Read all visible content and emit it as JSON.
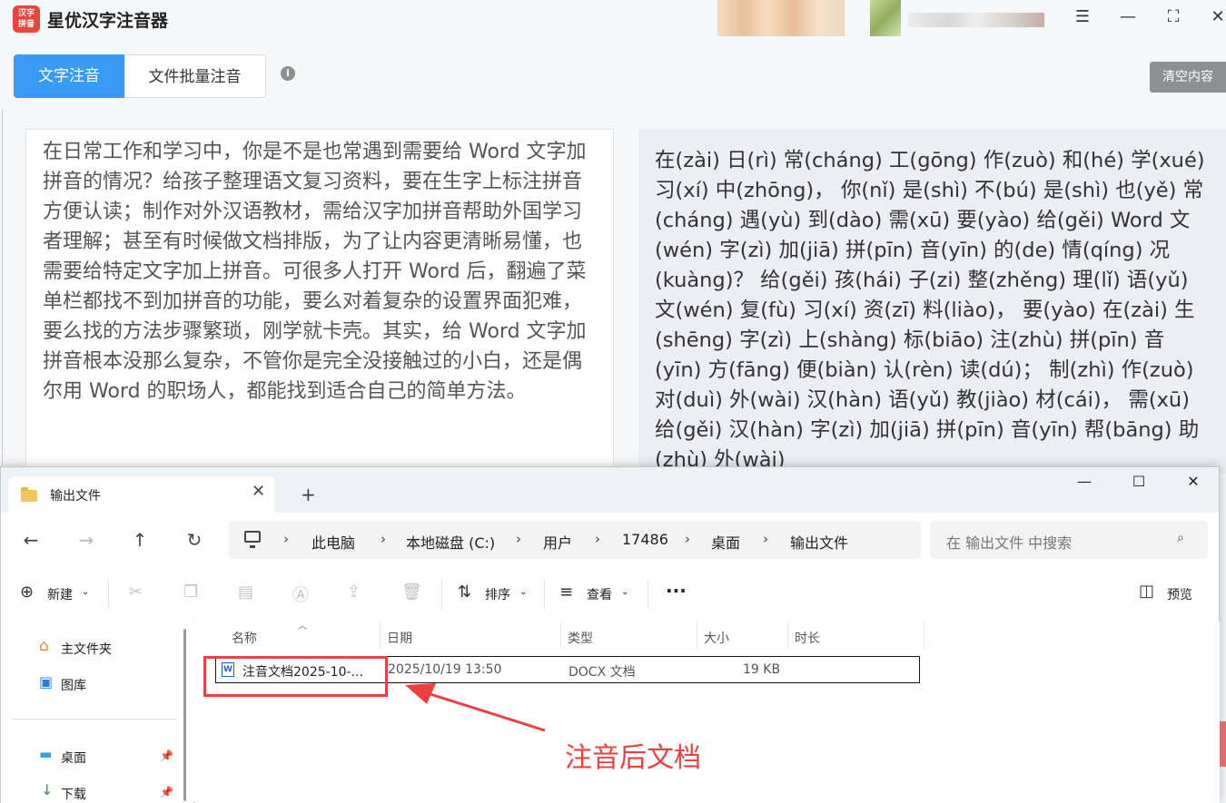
{
  "app": {
    "name": "星优汉字注音器",
    "logo_text": "汉字拼音",
    "tabs": [
      {
        "label": "文字注音"
      },
      {
        "label": "文件批量注音"
      }
    ],
    "clear_button": "清空内容",
    "input_text": "在日常工作和学习中，你是不是也常遇到需要给 Word 文字加拼音的情况？给孩子整理语文复习资料，要在生字上标注拼音方便认读；制作对外汉语教材，需给汉字加拼音帮助外国学习者理解；甚至有时候做文档排版，为了让内容更清晰易懂，也需要给特定文字加上拼音。可很多人打开 Word 后，翻遍了菜单栏都找不到加拼音的功能，要么对着复杂的设置界面犯难，要么找的方法步骤繁琐，刚学就卡壳。其实，给 Word 文字加拼音根本没那么复杂，不管你是完全没接触过的小白，还是偶尔用 Word 的职场人，都能找到适合自己的简单方法。",
    "output_text": "在(zài) 日(rì) 常(cháng) 工(gōng) 作(zuò) 和(hé) 学(xué) 习(xí) 中(zhōng)， 你(nǐ) 是(shì) 不(bú) 是(shì) 也(yě) 常(cháng) 遇(yù) 到(dào) 需(xū) 要(yào) 给(gěi) Word  文(wén) 字(zì) 加(jiā) 拼(pīn) 音(yīn) 的(de) 情(qíng) 况(kuàng)？ 给(gěi) 孩(hái) 子(zi) 整(zhěng) 理(lǐ) 语(yǔ) 文(wén) 复(fù) 习(xí) 资(zī) 料(liào)， 要(yào) 在(zài) 生(shēng) 字(zì) 上(shàng) 标(biāo) 注(zhù) 拼(pīn) 音(yīn) 方(fāng) 便(biàn) 认(rèn) 读(dú)； 制(zhì) 作(zuò) 对(duì) 外(wài) 汉(hàn) 语(yǔ) 教(jiào) 材(cái)， 需(xū) 给(gěi) 汉(hàn) 字(zì) 加(jiā) 拼(pīn) 音(yīn) 帮(bāng) 助(zhù) 外(wài)"
  },
  "explorer": {
    "tab_title": "输出文件",
    "breadcrumb": [
      "此电脑",
      "本地磁盘 (C:)",
      "用户",
      "17486",
      "桌面",
      "输出文件"
    ],
    "search_placeholder": "在 输出文件 中搜索",
    "commands": {
      "new": "新建",
      "sort": "排序",
      "view": "查看",
      "more": "···",
      "preview": "预览"
    },
    "sidebar": [
      {
        "label": "主文件夹"
      },
      {
        "label": "图库"
      },
      {
        "label": "桌面"
      },
      {
        "label": "下载"
      }
    ],
    "columns": [
      "名称",
      "日期",
      "类型",
      "大小",
      "时长"
    ],
    "files": [
      {
        "name": "注音文档2025-10-...",
        "date": "2025/10/19 13:50",
        "type": "DOCX 文档",
        "size": "19 KB"
      }
    ]
  },
  "annotation": {
    "label": "注音后文档",
    "color": "#ee4040"
  },
  "colors": {
    "accent": "#3a9bf5",
    "clear_button": "#8d8f93",
    "output_bg": "#ecedf5"
  }
}
